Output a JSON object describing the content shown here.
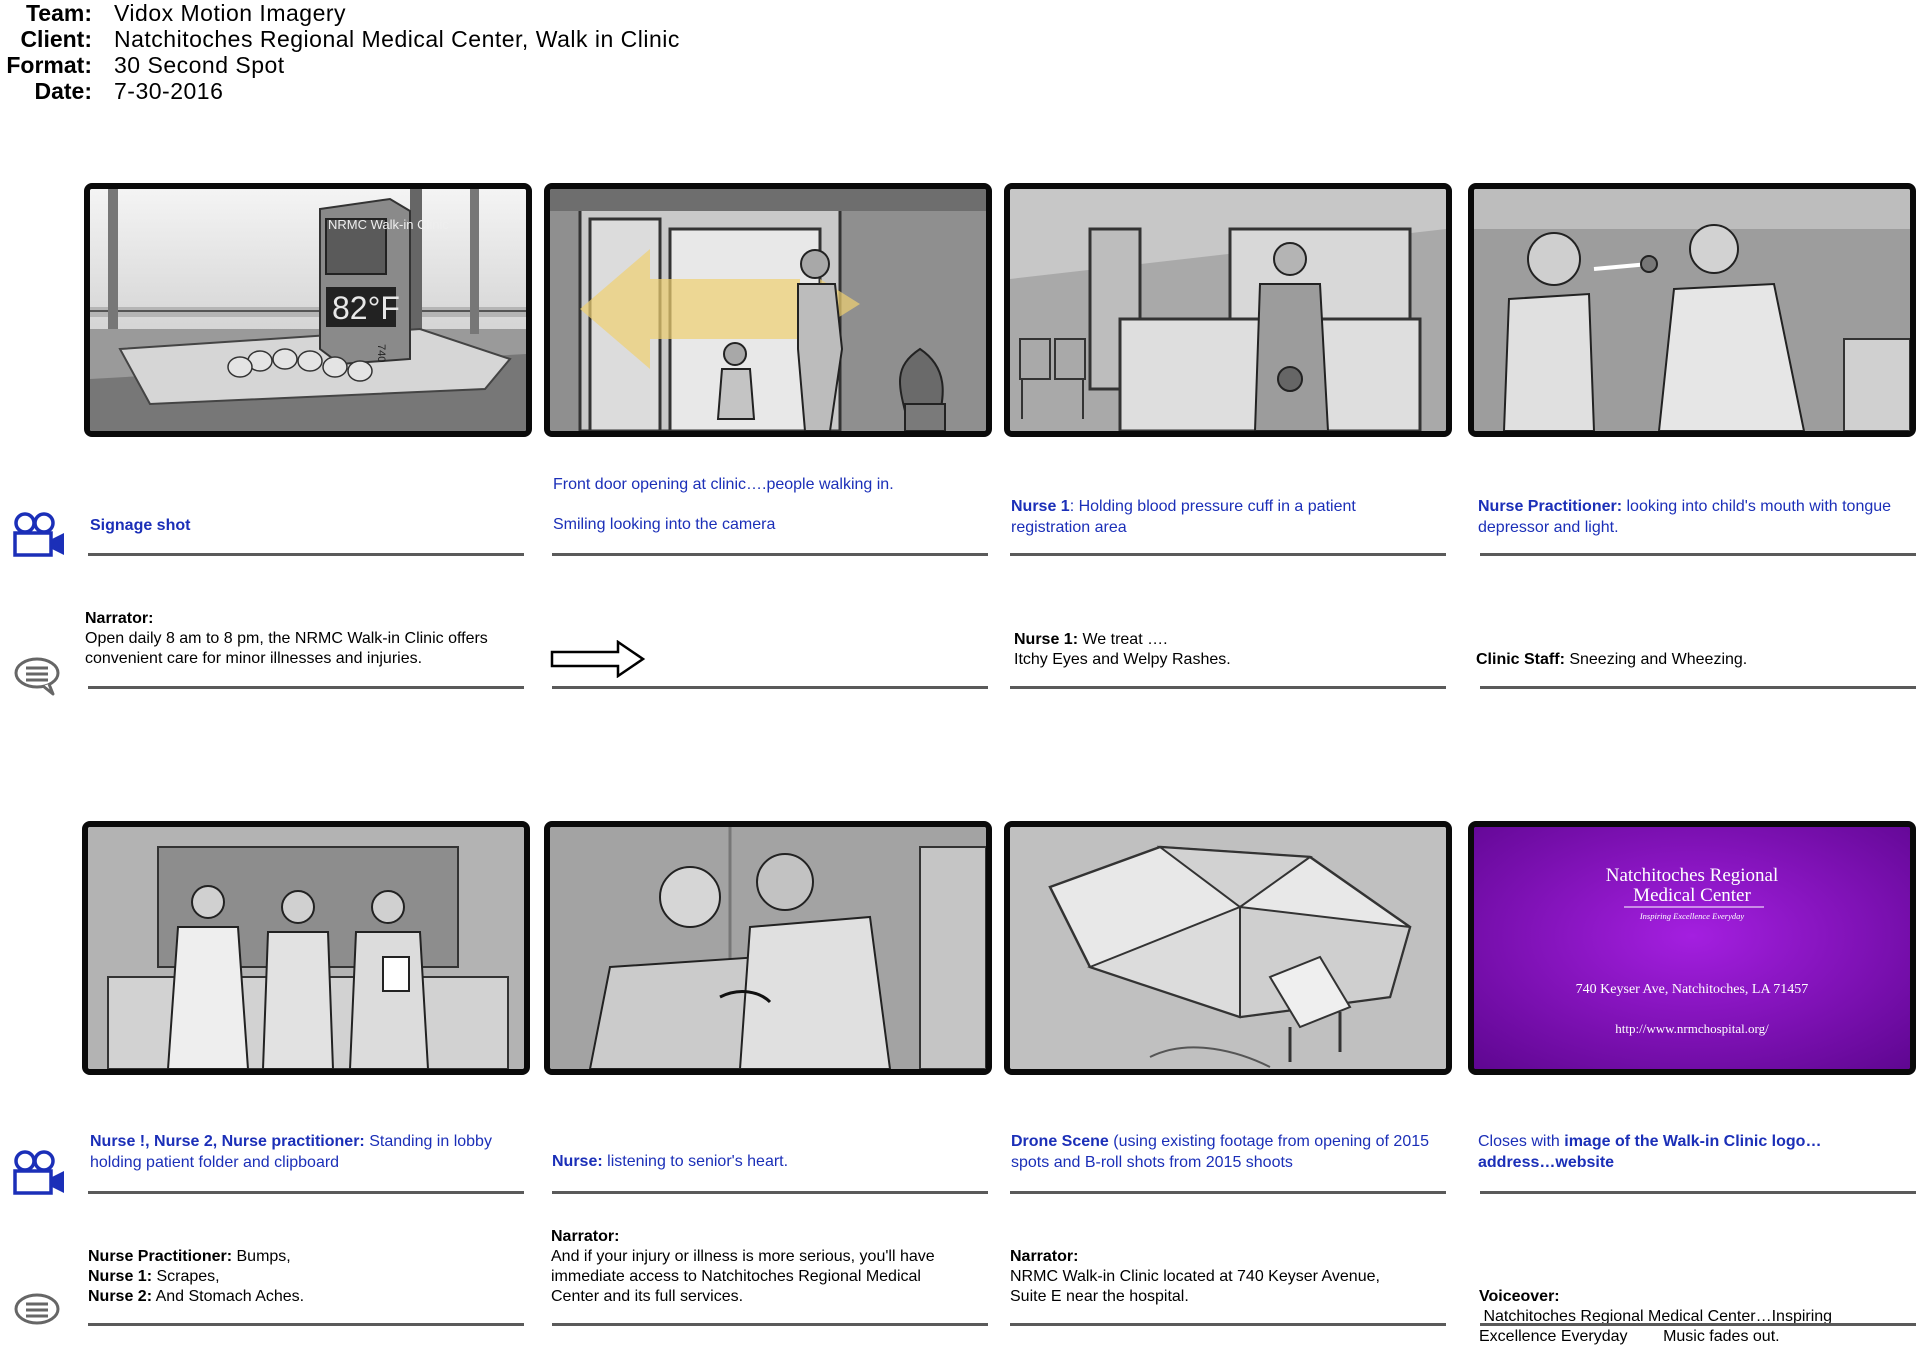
{
  "header": {
    "team_label": "Team:",
    "team": "Vidox Motion Imagery",
    "client_label": "Client:",
    "client": "Natchitoches Regional Medical Center, Walk in Clinic",
    "format_label": "Format:",
    "format": "30 Second Spot",
    "date_label": "Date:",
    "date": "7-30-2016"
  },
  "icons": {
    "camera": "video-camera-icon",
    "speech": "speech-bubble-icon",
    "arrow": "right-arrow-icon"
  },
  "colors": {
    "caption_blue": "#1b2fb8",
    "promo_purple": "#7a0aa8"
  },
  "panels": [
    {
      "sign_title": "NRMC Walk-in Clinic",
      "sign_temp": "82°F",
      "sign_number": "740",
      "shot_bold": "Signage shot",
      "shot_rest": "",
      "dialog_speaker": "Narrator:",
      "dialog_text": "Open daily 8 am to 8 pm, the NRMC Walk-in Clinic offers convenient care for minor illnesses and injuries."
    },
    {
      "shot_line1": "Front door opening at clinic….people walking in.",
      "shot_line2": "Smiling looking into the camera"
    },
    {
      "shot_bold": "Nurse 1",
      "shot_rest": ": Holding blood pressure cuff in a patient registration area",
      "dialog_speaker": "Nurse 1:",
      "dialog_rest": " We treat ….",
      "dialog_line2": "Itchy Eyes and Welpy Rashes."
    },
    {
      "shot_bold": "Nurse Practitioner:",
      "shot_rest": " looking into child's mouth with tongue depressor and light.",
      "dialog_speaker": "Clinic Staff:",
      "dialog_rest": " Sneezing and Wheezing."
    },
    {
      "shot_bold": "Nurse !, Nurse 2, Nurse practitioner:",
      "shot_rest": " Standing in lobby holding patient folder and clipboard",
      "dialog_l1_speaker": "Nurse Practitioner:",
      "dialog_l1_rest": " Bumps,",
      "dialog_l2_speaker": "Nurse 1:",
      "dialog_l2_rest": " Scrapes,",
      "dialog_l3_speaker": "Nurse 2:",
      "dialog_l3_rest": " And Stomach Aches."
    },
    {
      "shot_bold": "Nurse:",
      "shot_rest": " listening to senior's heart.",
      "dialog_speaker": "Narrator:",
      "dialog_text": "And if your injury or illness is more serious, you'll have immediate access to Natchitoches Regional Medical Center and its full services."
    },
    {
      "shot_bold": "Drone Scene",
      "shot_rest": " (using existing footage from opening of 2015 spots and B-roll shots from 2015 shoots",
      "dialog_speaker": "Narrator:",
      "dialog_text": "NRMC Walk-in Clinic located at 740 Keyser Avenue, Suite E near the hospital."
    },
    {
      "promo_title1": "Natchitoches Regional",
      "promo_title2": "Medical Center",
      "promo_tagline": "Inspiring Excellence Everyday",
      "promo_address": "740 Keyser Ave, Natchitoches, LA 71457",
      "promo_url": "http://www.nrmchospital.org/",
      "shot_rest": "Closes with ",
      "shot_bold": "image of the Walk-in Clinic logo…address…website",
      "dialog_speaker": "Voiceover:",
      "dialog_text": " Natchitoches Regional Medical Center…Inspiring Excellence Everyday        Music fades out."
    }
  ]
}
